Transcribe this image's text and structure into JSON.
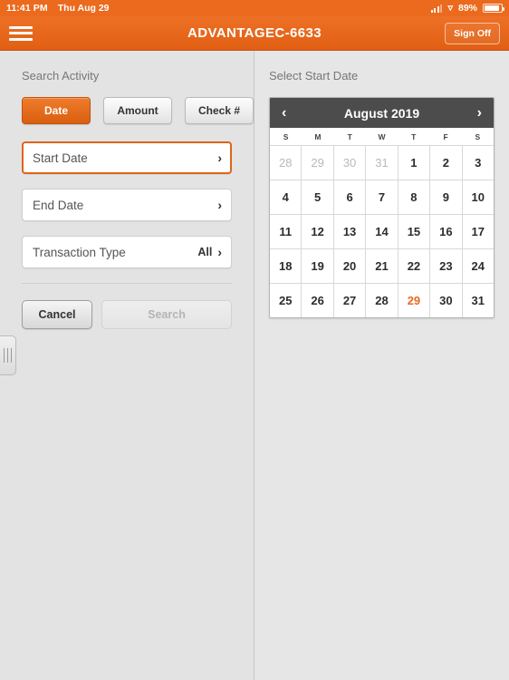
{
  "statusbar": {
    "time": "11:41 PM",
    "date": "Thu Aug 29",
    "battery_percent": "89%",
    "wifi_icon": "wifi-icon",
    "signal_icon": "cellular-signal-icon"
  },
  "navbar": {
    "menu_icon": "hamburger-menu-icon",
    "title": "ADVANTAGEC-6633",
    "sign_off_label": "Sign Off",
    "accent_color": "#e8671c"
  },
  "left_panel": {
    "title": "Search Activity",
    "segments": [
      {
        "label": "Date",
        "active": true
      },
      {
        "label": "Amount",
        "active": false
      },
      {
        "label": "Check #",
        "active": false
      }
    ],
    "fields": [
      {
        "label": "Start Date",
        "value": "",
        "focused": true
      },
      {
        "label": "End Date",
        "value": "",
        "focused": false
      },
      {
        "label": "Transaction Type",
        "value": "All",
        "focused": false
      }
    ],
    "cancel_label": "Cancel",
    "search_label": "Search",
    "search_enabled": false,
    "drag_handle_icon": "drag-handle-icon"
  },
  "right_panel": {
    "title": "Select Start Date",
    "calendar": {
      "month_label": "August 2019",
      "prev_icon": "chevron-left-icon",
      "next_icon": "chevron-right-icon",
      "weekdays": [
        "S",
        "M",
        "T",
        "W",
        "T",
        "F",
        "S"
      ],
      "today": 29,
      "highlight_color": "#e9691d",
      "weeks": [
        [
          {
            "day": "28",
            "muted": true
          },
          {
            "day": "29",
            "muted": true
          },
          {
            "day": "30",
            "muted": true
          },
          {
            "day": "31",
            "muted": true
          },
          {
            "day": "1",
            "muted": false
          },
          {
            "day": "2",
            "muted": false
          },
          {
            "day": "3",
            "muted": false
          }
        ],
        [
          {
            "day": "4",
            "muted": false
          },
          {
            "day": "5",
            "muted": false
          },
          {
            "day": "6",
            "muted": false
          },
          {
            "day": "7",
            "muted": false
          },
          {
            "day": "8",
            "muted": false
          },
          {
            "day": "9",
            "muted": false
          },
          {
            "day": "10",
            "muted": false
          }
        ],
        [
          {
            "day": "11",
            "muted": false
          },
          {
            "day": "12",
            "muted": false
          },
          {
            "day": "13",
            "muted": false
          },
          {
            "day": "14",
            "muted": false
          },
          {
            "day": "15",
            "muted": false
          },
          {
            "day": "16",
            "muted": false
          },
          {
            "day": "17",
            "muted": false
          }
        ],
        [
          {
            "day": "18",
            "muted": false
          },
          {
            "day": "19",
            "muted": false
          },
          {
            "day": "20",
            "muted": false
          },
          {
            "day": "21",
            "muted": false
          },
          {
            "day": "22",
            "muted": false
          },
          {
            "day": "23",
            "muted": false
          },
          {
            "day": "24",
            "muted": false
          }
        ],
        [
          {
            "day": "25",
            "muted": false
          },
          {
            "day": "26",
            "muted": false
          },
          {
            "day": "27",
            "muted": false
          },
          {
            "day": "28",
            "muted": false
          },
          {
            "day": "29",
            "muted": false,
            "today": true
          },
          {
            "day": "30",
            "muted": false
          },
          {
            "day": "31",
            "muted": false
          }
        ]
      ]
    }
  }
}
